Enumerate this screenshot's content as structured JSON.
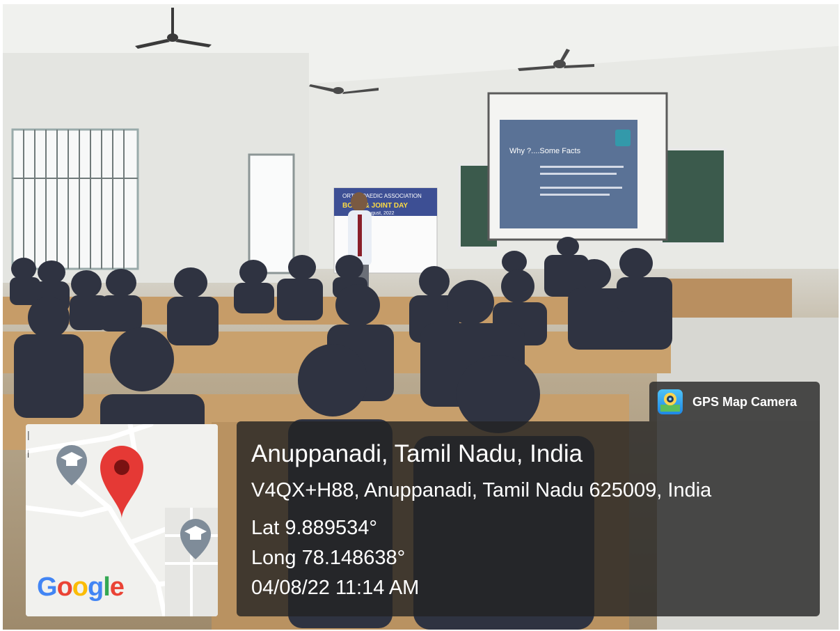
{
  "badge": {
    "app_name": "GPS Map Camera",
    "icon": "gps-map-camera-icon"
  },
  "location": {
    "place": "Anuppanadi, Tamil Nadu, India",
    "address": "V4QX+H88, Anuppanadi, Tamil Nadu 625009, India",
    "latitude": "Lat 9.889534°",
    "longitude": "Long 78.148638°",
    "datetime": "04/08/22 11:14 AM"
  },
  "map": {
    "attribution_letters": [
      "G",
      "o",
      "o",
      "g",
      "l",
      "e"
    ],
    "attribution_colors": [
      "#4285F4",
      "#EA4335",
      "#FBBC05",
      "#4285F4",
      "#34A853",
      "#EA4335"
    ],
    "pin_color": "#E53935",
    "poi_icon": "school-cap-icon"
  },
  "photo": {
    "projector_slide": {
      "title": "Why ?....Some Facts"
    },
    "banner": {
      "line1": "ORTHOPAEDIC ASSOCIATION",
      "line2": "BONE & JOINT DAY",
      "line3": "4th August, 2022"
    }
  }
}
